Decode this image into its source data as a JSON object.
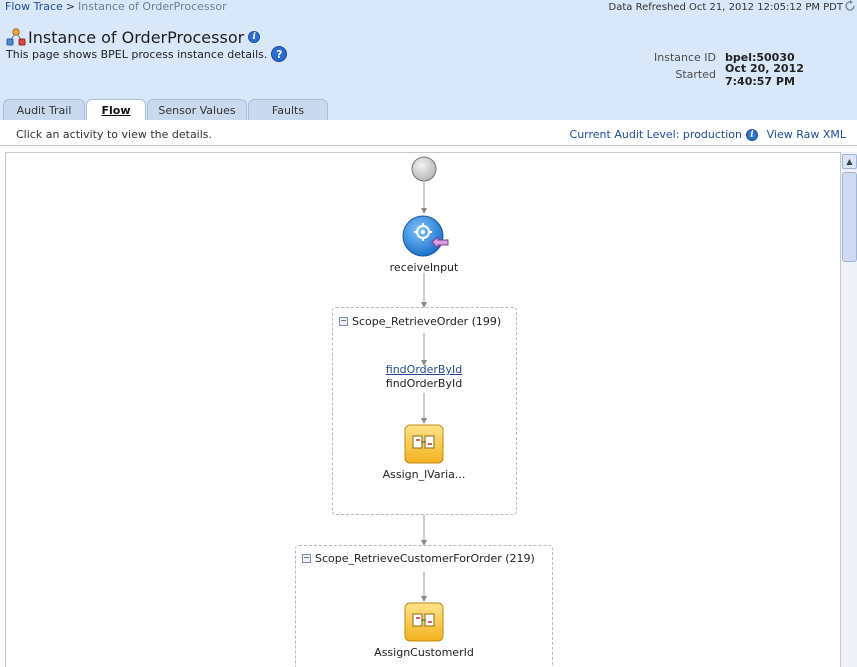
{
  "breadcrumb": {
    "root": "Flow Trace",
    "separator": ">",
    "current": "Instance of OrderProcessor"
  },
  "refresh_text": "Data Refreshed Oct 21, 2012 12:05:12 PM PDT",
  "title": "Instance of OrderProcessor",
  "subtitle": "This page shows BPEL process instance details.",
  "instance": {
    "id_label": "Instance ID",
    "id_value": "bpel:50030",
    "started_label": "Started",
    "started_value": "Oct 20, 2012 7:40:57 PM"
  },
  "tabs": [
    {
      "label": "Audit Trail",
      "active": false
    },
    {
      "label": "Flow",
      "active": true
    },
    {
      "label": "Sensor Values",
      "active": false
    },
    {
      "label": "Faults",
      "active": false
    }
  ],
  "toolbar": {
    "hint": "Click an activity to view the details.",
    "audit_level": "Current Audit Level: production",
    "view_raw": "View Raw XML"
  },
  "flow": {
    "receive_label": "receiveInput",
    "scope1_title": "Scope_RetrieveOrder (199)",
    "invoke_link": "findOrderById",
    "invoke_label": "findOrderById",
    "assign1_label": "Assign_lVaria...",
    "scope2_title": "Scope_RetrieveCustomerForOrder (219)",
    "assign2_label": "AssignCustomerId"
  },
  "colors": {
    "header_bg": "#d9e8f9",
    "link": "#1f4a96",
    "assign_icon": "#f7c83a",
    "receive_icon": "#3a8fd8"
  }
}
